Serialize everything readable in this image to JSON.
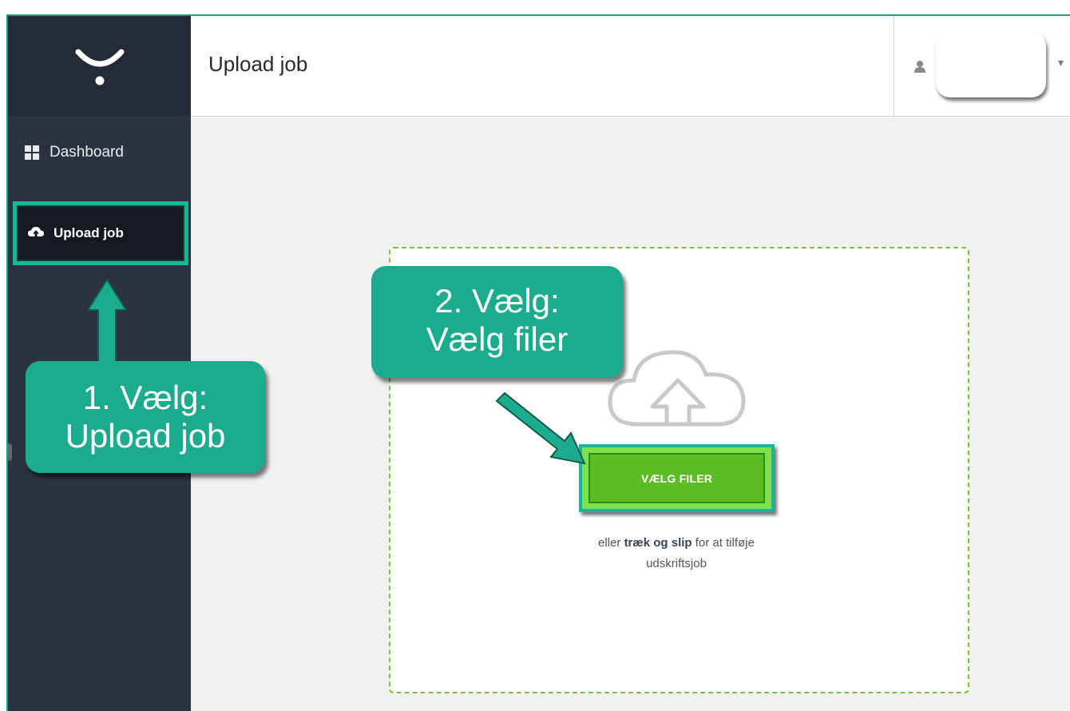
{
  "sidebar": {
    "logo_icon": "brand-smile-logo",
    "items": [
      {
        "label": "Dashboard",
        "icon": "grid-icon"
      },
      {
        "label": "Upload job",
        "icon": "cloud-upload-icon"
      }
    ]
  },
  "header": {
    "title": "Upload job",
    "user_icon": "user-icon",
    "caret": "▾"
  },
  "upload": {
    "button_label": "VÆLG FILER",
    "help_prefix": "eller ",
    "help_bold": "træk og slip",
    "help_suffix": " for at tilføje",
    "help_line2": "udskriftsjob"
  },
  "callouts": {
    "step1_line1": "1. Vælg:",
    "step1_line2": "Upload job",
    "step2_line1": "2. Vælg:",
    "step2_line2": "Vælg filer"
  },
  "colors": {
    "accent": "#1cab8c",
    "sidebar": "#2c3340",
    "button": "#5cbd23",
    "dropzone_border": "#7ac143"
  }
}
